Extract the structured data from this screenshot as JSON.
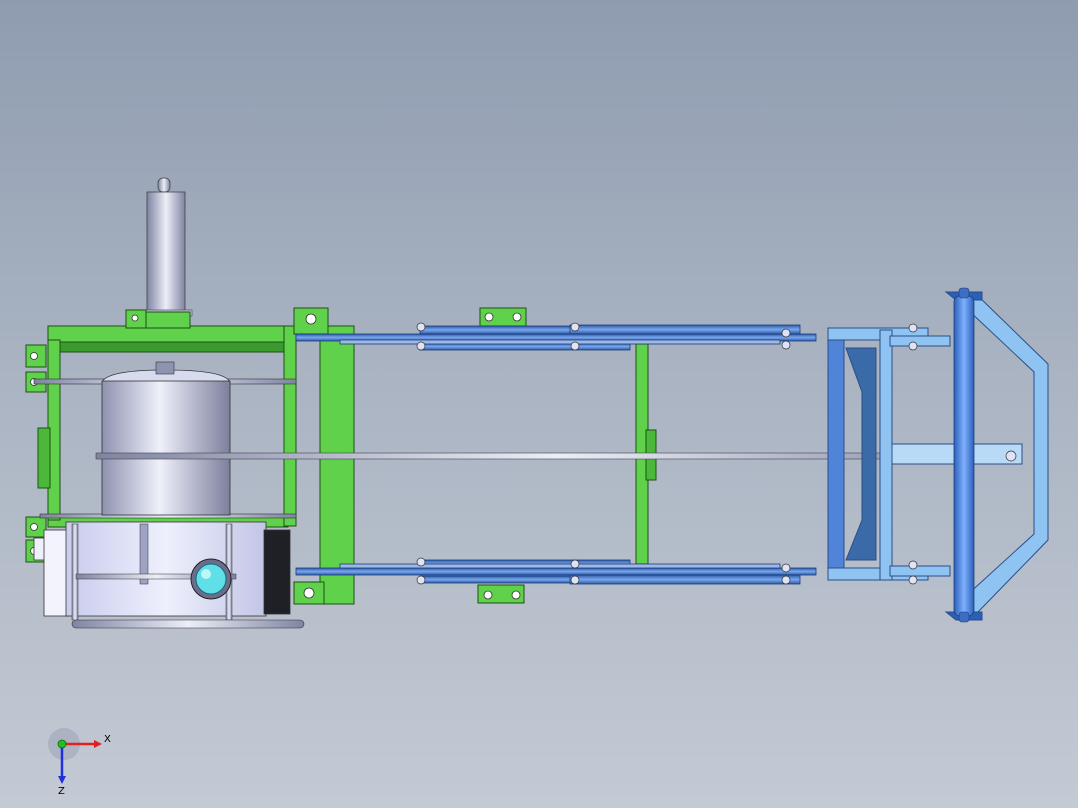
{
  "viewport": {
    "background_top": "#8f9cb0",
    "background_bottom": "#c4cad4"
  },
  "model": {
    "colors": {
      "frame_green": "#5fd14a",
      "frame_green_dark": "#2f7d22",
      "arm_blue": "#4f84d9",
      "arm_blue_dark": "#2a4f97",
      "head_light_blue": "#8ec3f2",
      "head_blue_dark": "#3a6aa8",
      "cylinder_gray": "#c8cbe0",
      "box_gray": "#d9dcf0",
      "lens_cyan": "#5fe0e8"
    }
  },
  "triad": {
    "x_label": "X",
    "z_label": "Z",
    "x_color": "#e02020",
    "y_color": "#20c020",
    "z_color": "#2030e0"
  }
}
